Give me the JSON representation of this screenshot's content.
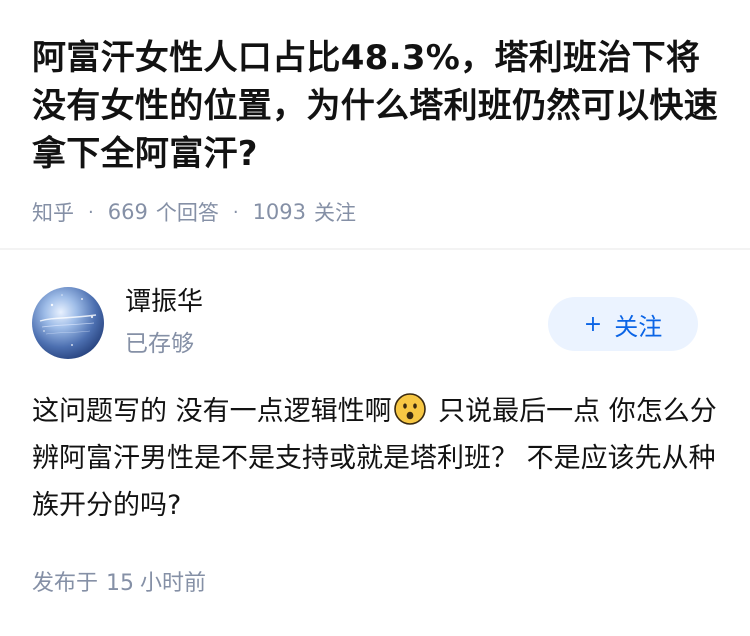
{
  "question": {
    "title": "阿富汗女性人口占比48.3%，塔利班治下将没有女性的位置，为什么塔利班仍然可以快速拿下全阿富汗?",
    "source": "知乎",
    "separator": "·",
    "answer_count": "669",
    "answer_label": "个回答",
    "follower_count": "1093",
    "follower_label": "关注"
  },
  "author": {
    "name": "谭振华",
    "badge": "已存够",
    "avatar_icon": "avatar-image"
  },
  "follow_button": {
    "icon": "plus-icon",
    "icon_glyph": "+",
    "label": "关注"
  },
  "answer": {
    "text_before_emoji": "这问题写的 没有一点逻辑性啊",
    "emoji": "surprised-face-emoji",
    "text_after_emoji": " 只说最后一点 你怎么分辨阿富汗男性是不是支持或就是塔利班？ 不是应该先从种族开分的吗?"
  },
  "timestamp": {
    "prefix": "发布于",
    "value": "15",
    "unit": "小时前"
  },
  "colors": {
    "title": "#121212",
    "meta": "#8590a6",
    "follow_bg": "#ebf3ff",
    "follow_text": "#0a64e6",
    "emoji": "#f7c744"
  }
}
